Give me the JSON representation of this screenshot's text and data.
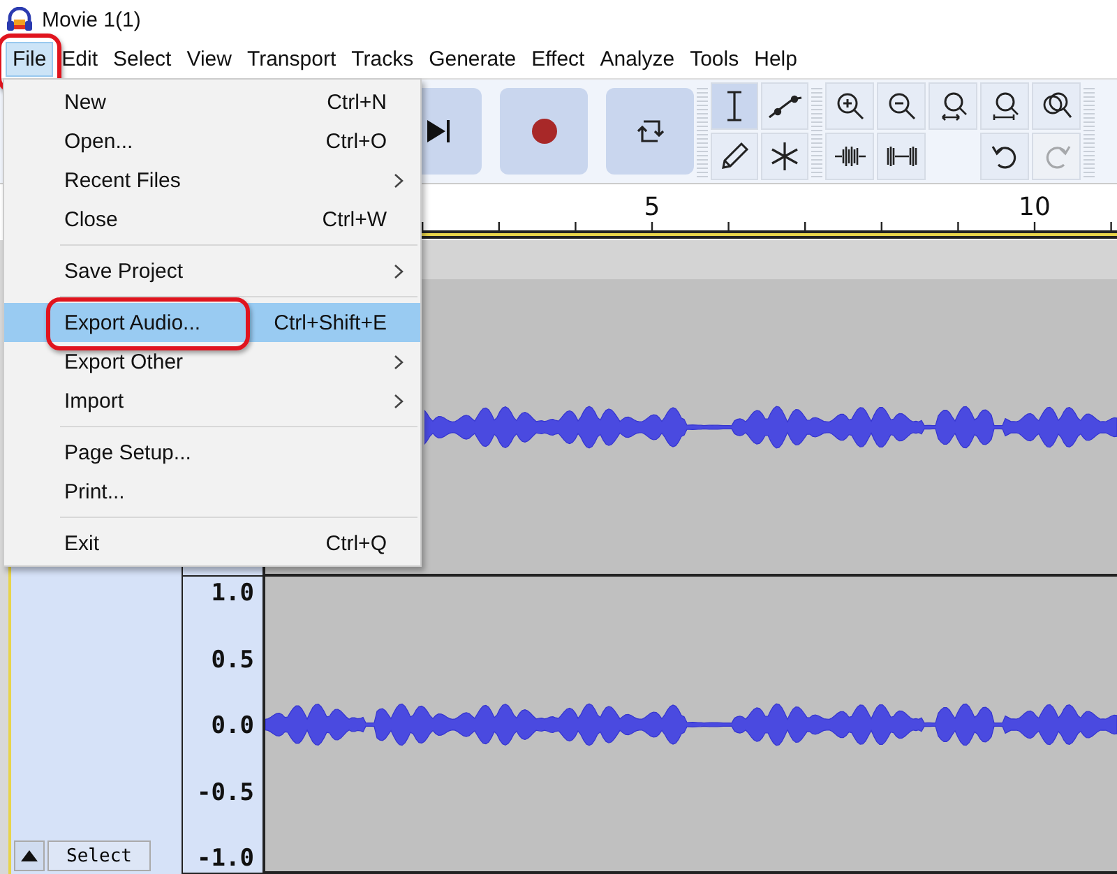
{
  "window": {
    "title": "Movie 1(1)"
  },
  "menubar": [
    {
      "label": "File",
      "selected": true,
      "annotated": true
    },
    {
      "label": "Edit",
      "selected": false,
      "annotated": false
    },
    {
      "label": "Select",
      "selected": false,
      "annotated": false
    },
    {
      "label": "View",
      "selected": false,
      "annotated": false
    },
    {
      "label": "Transport",
      "selected": false,
      "annotated": false
    },
    {
      "label": "Tracks",
      "selected": false,
      "annotated": false
    },
    {
      "label": "Generate",
      "selected": false,
      "annotated": false
    },
    {
      "label": "Effect",
      "selected": false,
      "annotated": false
    },
    {
      "label": "Analyze",
      "selected": false,
      "annotated": false
    },
    {
      "label": "Tools",
      "selected": false,
      "annotated": false
    },
    {
      "label": "Help",
      "selected": false,
      "annotated": false
    }
  ],
  "file_menu": [
    {
      "kind": "item",
      "label": "New",
      "shortcut": "Ctrl+N",
      "submenu": false,
      "selected": false,
      "annotated": false
    },
    {
      "kind": "item",
      "label": "Open...",
      "shortcut": "Ctrl+O",
      "submenu": false,
      "selected": false,
      "annotated": false
    },
    {
      "kind": "item",
      "label": "Recent Files",
      "submenu": true,
      "selected": false,
      "annotated": false
    },
    {
      "kind": "item",
      "label": "Close",
      "shortcut": "Ctrl+W",
      "submenu": false,
      "selected": false,
      "annotated": false
    },
    {
      "kind": "separator"
    },
    {
      "kind": "item",
      "label": "Save Project",
      "submenu": true,
      "selected": false,
      "annotated": false
    },
    {
      "kind": "separator"
    },
    {
      "kind": "item",
      "label": "Export Audio...",
      "shortcut": "Ctrl+Shift+E",
      "submenu": false,
      "selected": true,
      "annotated": true
    },
    {
      "kind": "item",
      "label": "Export Other",
      "submenu": true,
      "selected": false,
      "annotated": false
    },
    {
      "kind": "item",
      "label": "Import",
      "submenu": true,
      "selected": false,
      "annotated": false
    },
    {
      "kind": "separator"
    },
    {
      "kind": "item",
      "label": "Page Setup...",
      "submenu": false,
      "selected": false,
      "annotated": false
    },
    {
      "kind": "item",
      "label": "Print...",
      "submenu": false,
      "selected": false,
      "annotated": false
    },
    {
      "kind": "separator"
    },
    {
      "kind": "item",
      "label": "Exit",
      "shortcut": "Ctrl+Q",
      "submenu": false,
      "selected": false,
      "annotated": false
    }
  ],
  "transport": [
    {
      "kind": "skip-end"
    },
    {
      "kind": "record"
    },
    {
      "kind": "loop"
    }
  ],
  "tools": [
    {
      "kind": "select",
      "selected": true
    },
    {
      "kind": "envelope",
      "selected": false
    },
    {
      "kind": "draw",
      "selected": false
    },
    {
      "kind": "multi",
      "selected": false
    }
  ],
  "edit_tools": [
    {
      "kind": "zoom-in",
      "disabled": false
    },
    {
      "kind": "zoom-out",
      "disabled": false
    },
    {
      "kind": "fit-selection",
      "disabled": false
    },
    {
      "kind": "fit-project",
      "disabled": false
    },
    {
      "kind": "zoom-toggle",
      "disabled": false
    },
    {
      "kind": "trim",
      "disabled": false
    },
    {
      "kind": "silence",
      "disabled": false
    },
    {
      "kind": "blank"
    },
    {
      "kind": "undo",
      "disabled": false
    },
    {
      "kind": "redo",
      "disabled": true
    }
  ],
  "ruler": {
    "labels": [
      "5",
      "10"
    ]
  },
  "track": {
    "scale": [
      "1.0",
      "0.5",
      "0.0",
      "-0.5",
      "-1.0"
    ],
    "select_button": "Select"
  }
}
